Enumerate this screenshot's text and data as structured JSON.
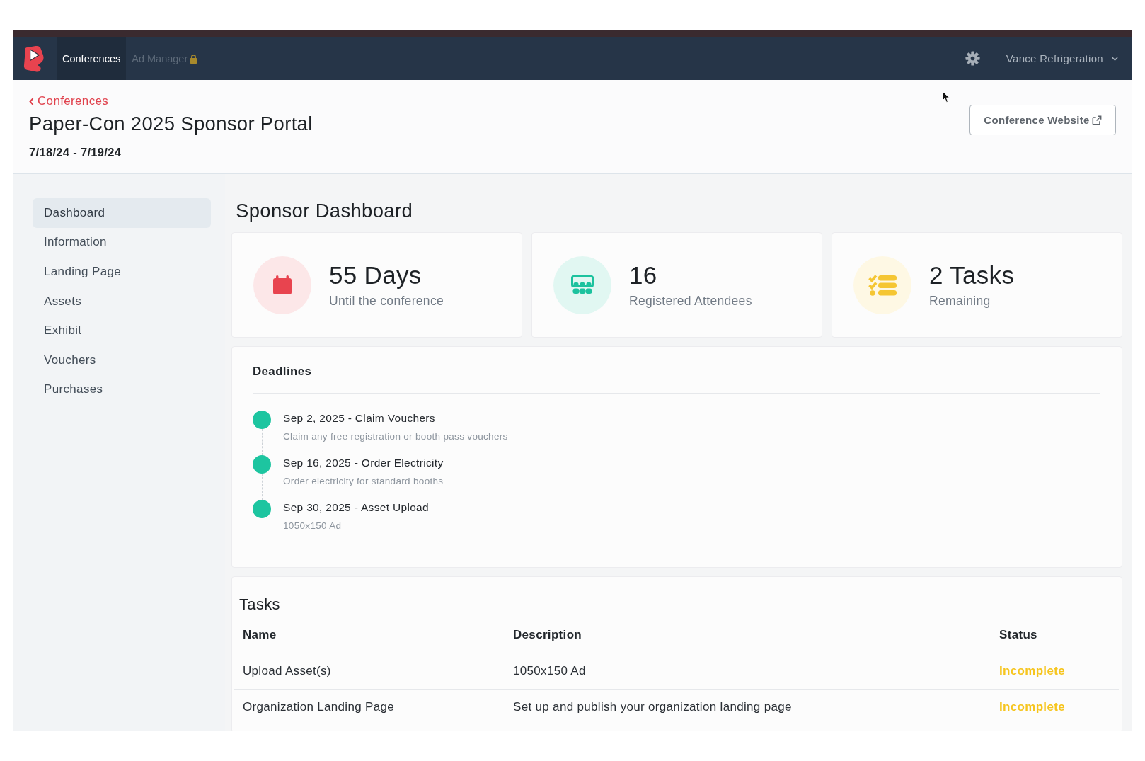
{
  "navbar": {
    "tabs": [
      {
        "label": "Conferences",
        "selected": true,
        "locked": false
      },
      {
        "label": "Ad Manager",
        "selected": false,
        "locked": true
      }
    ],
    "account_menu": "Vance Refrigeration"
  },
  "header": {
    "back_link": "Conferences",
    "title": "Paper-Con 2025 Sponsor Portal",
    "dates": "7/18/24 - 7/19/24",
    "website_button": "Conference Website"
  },
  "sidebar": {
    "items": [
      {
        "label": "Dashboard",
        "selected": true
      },
      {
        "label": "Information",
        "selected": false
      },
      {
        "label": "Landing Page",
        "selected": false
      },
      {
        "label": "Assets",
        "selected": false
      },
      {
        "label": "Exhibit",
        "selected": false
      },
      {
        "label": "Vouchers",
        "selected": false
      },
      {
        "label": "Purchases",
        "selected": false
      }
    ]
  },
  "dashboard": {
    "title": "Sponsor Dashboard",
    "stats": [
      {
        "kind": "calendar",
        "value": "55 Days",
        "caption": "Until the conference",
        "color": "#e8444f"
      },
      {
        "kind": "attendees",
        "value": "16",
        "caption": "Registered Attendees",
        "color": "#1cc29e"
      },
      {
        "kind": "tasks",
        "value": "2 Tasks",
        "caption": "Remaining",
        "color": "#f5c633"
      }
    ],
    "deadlines": {
      "title": "Deadlines",
      "items": [
        {
          "title": "Sep 2, 2025 - Claim Vouchers",
          "description": "Claim any free registration or booth pass vouchers"
        },
        {
          "title": "Sep 16, 2025 - Order Electricity",
          "description": "Order electricity for standard booths"
        },
        {
          "title": "Sep 30, 2025 - Asset Upload",
          "description": "1050x150 Ad"
        }
      ]
    },
    "tasks": {
      "title": "Tasks",
      "columns": [
        "Name",
        "Description",
        "Status"
      ],
      "rows": [
        {
          "name": "Upload Asset(s)",
          "description": "1050x150 Ad",
          "status": "Incomplete",
          "color": "#f6c51e"
        },
        {
          "name": "Organization Landing Page",
          "description": "Set up and publish your organization landing page",
          "status": "Incomplete",
          "color": "#f6c51e"
        }
      ]
    }
  }
}
